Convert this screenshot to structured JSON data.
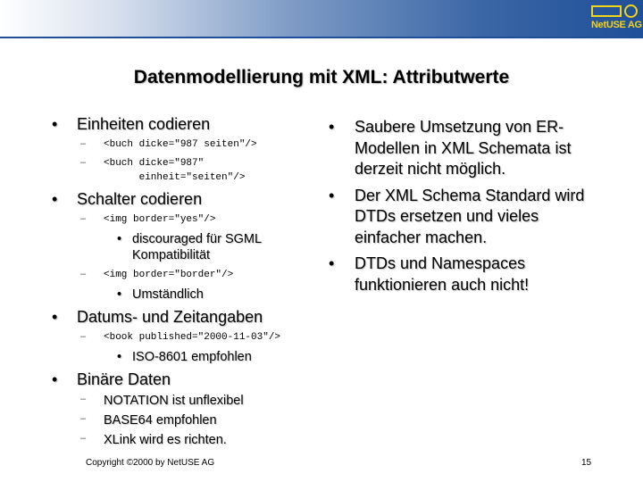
{
  "header": {
    "logo_text": "NetUSE AG",
    "colors": {
      "bar_start": "#ffffff",
      "bar_end": "#1f4f98",
      "logo": "#f2d41a"
    }
  },
  "slide": {
    "title": "Datenmodellierung mit XML: Attributwerte",
    "left": {
      "b1": "Einheiten codieren",
      "b1_s1": "<buch dicke=\"987 seiten\"/>",
      "b1_s2": "<buch dicke=\"987\"\n      einheit=\"seiten\"/>",
      "b2": "Schalter codieren",
      "b2_s1": "<img border=\"yes\"/>",
      "b2_s1_n1": "discouraged für SGML Kompatibilität",
      "b2_s2": "<img border=\"border\"/>",
      "b2_s2_n1": "Umständlich",
      "b3": "Datums- und Zeitangaben",
      "b3_s1": "<book published=\"2000-11-03\"/>",
      "b3_s1_n1": "ISO-8601 empfohlen",
      "b4": "Binäre Daten",
      "b4_s1": "NOTATION ist unflexibel",
      "b4_s2": "BASE64 empfohlen",
      "b4_s3": "XLink wird es richten."
    },
    "right": {
      "b1": "Saubere Umsetzung von ER-Modellen in XML Schemata ist derzeit nicht möglich.",
      "b2": "Der XML Schema Standard wird DTDs ersetzen und vieles einfacher machen.",
      "b3": "DTDs und Namespaces funktionieren auch nicht!"
    },
    "bullet": "•",
    "dash": "–"
  },
  "footer": {
    "copyright": "Copyright ©2000 by NetUSE AG",
    "page_number": "15"
  }
}
